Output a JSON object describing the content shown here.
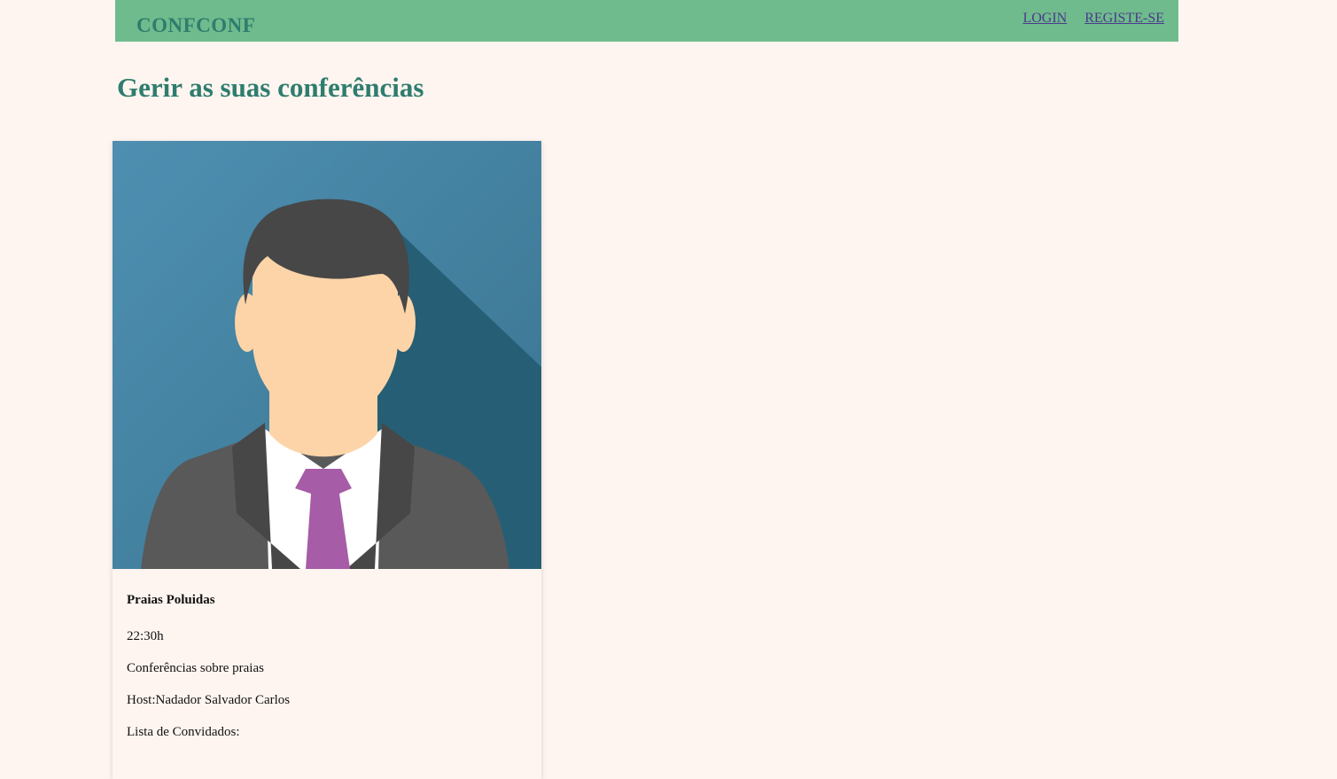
{
  "header": {
    "brand": "CONFCONF",
    "nav": {
      "login": "LOGIN",
      "register": "REGISTE-SE"
    }
  },
  "main": {
    "title": "Gerir as suas conferências"
  },
  "conference": {
    "title": "Praias Poluidas",
    "time": "22:30h",
    "description": "Conferências sobre praias",
    "host": "Host:Nadador Salvador Carlos",
    "guests_label": "Lista de Convidados:"
  },
  "colors": {
    "background": "#fff5f0",
    "header": "#6fbb8d",
    "accent": "#2e7d6e",
    "link": "#4a3b8c"
  },
  "icons": {
    "avatar": "person-avatar-icon"
  }
}
